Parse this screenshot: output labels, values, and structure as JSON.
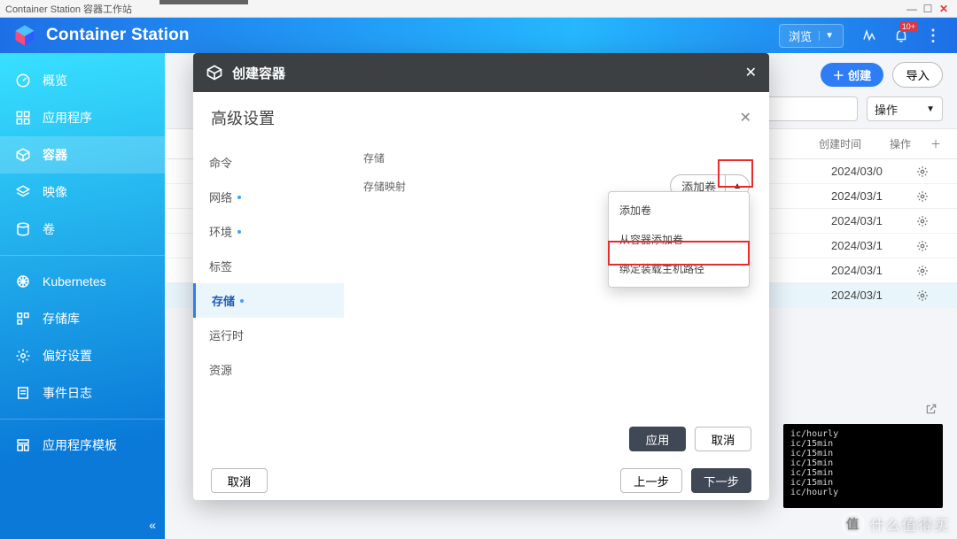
{
  "window": {
    "title": "Container Station 容器工作站"
  },
  "header": {
    "app_name": "Container Station",
    "browse_btn": "浏览",
    "notification_badge": "10+"
  },
  "sidebar": {
    "items": [
      {
        "label": "概览"
      },
      {
        "label": "应用程序"
      },
      {
        "label": "容器"
      },
      {
        "label": "映像"
      },
      {
        "label": "卷"
      },
      {
        "label": "Kubernetes"
      },
      {
        "label": "存储库"
      },
      {
        "label": "偏好设置"
      },
      {
        "label": "事件日志"
      },
      {
        "label": "应用程序模板"
      }
    ]
  },
  "main": {
    "create_btn": "创建",
    "import_btn": "导入",
    "op_select": "操作",
    "col_created": "创建时间",
    "col_ops": "操作",
    "rows": [
      {
        "created": "2024/03/0"
      },
      {
        "created": "2024/03/1"
      },
      {
        "created": "2024/03/1"
      },
      {
        "created": "2024/03/1"
      },
      {
        "created": "2024/03/1"
      },
      {
        "created": "2024/03/1"
      }
    ]
  },
  "terminal_lines": [
    "ic/hourly",
    "ic/15min",
    "ic/15min",
    "ic/15min",
    "ic/15min",
    "ic/15min",
    "ic/hourly"
  ],
  "modal": {
    "title": "创建容器",
    "cancel": "取消",
    "prev": "上一步",
    "next": "下一步"
  },
  "adv": {
    "title": "高级设置",
    "nav": [
      {
        "label": "命令",
        "dot": false
      },
      {
        "label": "网络",
        "dot": true
      },
      {
        "label": "环境",
        "dot": true
      },
      {
        "label": "标签",
        "dot": false
      },
      {
        "label": "存储",
        "dot": true
      },
      {
        "label": "运行时",
        "dot": false
      },
      {
        "label": "资源",
        "dot": false
      }
    ],
    "section_label": "存储",
    "mapping_label": "存储映射",
    "add_volume": "添加卷",
    "menu": [
      "添加卷",
      "从容器添加卷",
      "绑定装载主机路径"
    ],
    "apply": "应用",
    "cancel": "取消"
  },
  "watermark": "什么值得买"
}
